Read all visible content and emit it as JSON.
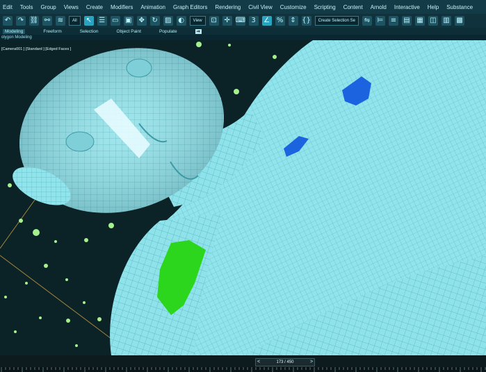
{
  "menubar": {
    "items": [
      "Edit",
      "Tools",
      "Group",
      "Views",
      "Create",
      "Modifiers",
      "Animation",
      "Graph Editors",
      "Rendering",
      "Civil View",
      "Customize",
      "Scripting",
      "Content",
      "Arnold",
      "Interactive",
      "Help",
      "Substance"
    ]
  },
  "toolbar": {
    "filter_value": "All",
    "view_value": "View",
    "selection_set_placeholder": "Create Selection Se",
    "icons": [
      "undo-icon",
      "redo-icon",
      "link-icon",
      "unlink-icon",
      "bind-icon",
      "select-icon",
      "select-by-name-icon",
      "rect-selection-icon",
      "window-crossing-icon",
      "move-icon",
      "rotate-icon",
      "scale-icon",
      "place-icon",
      "reference-coord-icon",
      "pivot-icon",
      "select-manipulate-icon",
      "keyboard-shortcut-icon",
      "snap-3d-icon",
      "angle-snap-icon",
      "percent-snap-icon",
      "spinner-snap-icon",
      "edit-named-sets-icon",
      "mirror-icon",
      "align-icon",
      "layer-explorer-icon",
      "toggle-ribbon-icon",
      "curve-editor-icon",
      "schematic-view-icon",
      "material-editor-icon",
      "render-setup-icon"
    ],
    "snap_label": "3",
    "percent_label": "%",
    "mirror_label": "{}"
  },
  "ribbon": {
    "tabs": [
      "Modeling",
      "Freeform",
      "Selection",
      "Object Paint",
      "Populate"
    ],
    "active_tab": "Modeling",
    "sub_label": "olygon Modeling"
  },
  "viewport": {
    "label": "[Camera001 ] [Standard ] [Edged Faces ]",
    "colors": {
      "mesh": "#8fe2ea",
      "wire": "#4fb2bd",
      "bg": "#0b2227",
      "dots": "#a6f08e",
      "green_obj": "#2bd61d",
      "blue_obj": "#1c63e0",
      "grid": "#caa040"
    }
  },
  "timeline": {
    "frame": "173 / 450",
    "prev": "<",
    "next": ">"
  }
}
